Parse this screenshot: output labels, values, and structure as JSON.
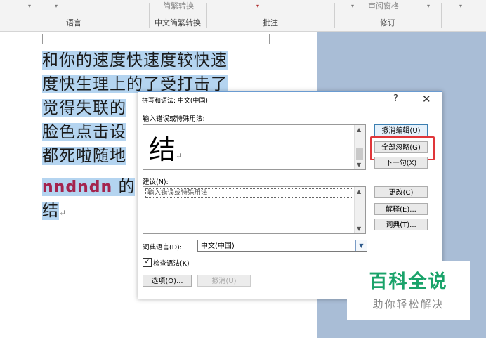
{
  "ribbon": {
    "top_partial": "简繁转换",
    "top_partial_2": "审阅窗格",
    "groups": [
      "语言",
      "中文简繁转换",
      "批注",
      "修订"
    ]
  },
  "document": {
    "lines": [
      "和你的速度快速度较快速",
      "度快生理上的了受打击了",
      "觉得失联的",
      "脸色点击设",
      "都死啦随地",
      "nndndn",
      "的",
      "结"
    ]
  },
  "dialog": {
    "title": "拼写和语法: 中文(中国)",
    "help_label": "?",
    "close_label": "✕",
    "error_label": "输入错误或特殊用法:",
    "error_text": "结",
    "ignore_once_button": "撤消编辑(U)",
    "ignore_all_button": "全部忽略(G)",
    "next_sentence_button": "下一句(X)",
    "suggestions_label": "建议(N):",
    "suggestions": [
      "输入错误或特殊用法"
    ],
    "change_button": "更改(C)",
    "explain_button": "解释(E)...",
    "dictionary_button": "词典(T)...",
    "language_label": "词典语言(D):",
    "language_value": "中文(中国)",
    "check_grammar_label": "检查语法(K)",
    "check_grammar_checked": true,
    "options_button": "选项(O)...",
    "cancel_button": "撤消(U)"
  },
  "watermark": {
    "title": "百科全说",
    "subtitle": "助你轻松解决"
  }
}
